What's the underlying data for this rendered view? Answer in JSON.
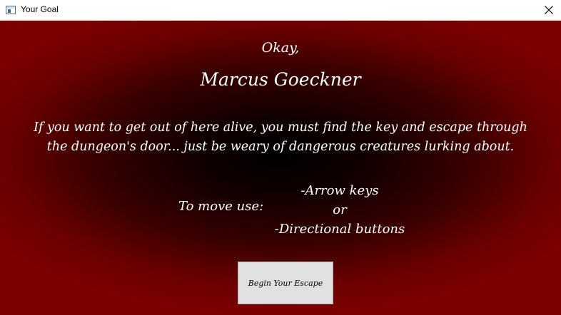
{
  "window": {
    "title": "Your Goal",
    "icon": "app-window-icon",
    "close_icon": "close-icon"
  },
  "content": {
    "greeting": "Okay,",
    "player_name": "Marcus Goeckner",
    "goal_text": "If you want to get out of here alive, you must find the key and escape through the dungeon's door... just be weary of dangerous creatures lurking about.",
    "move_label": "To move use:",
    "controls": [
      "-Arrow keys",
      "or",
      "-Directional buttons"
    ],
    "begin_button": "Begin Your Escape"
  },
  "colors": {
    "background_edge": "#7d0000",
    "background_center": "#000000",
    "text": "#ffffff",
    "button_bg": "#e1e1e1"
  }
}
